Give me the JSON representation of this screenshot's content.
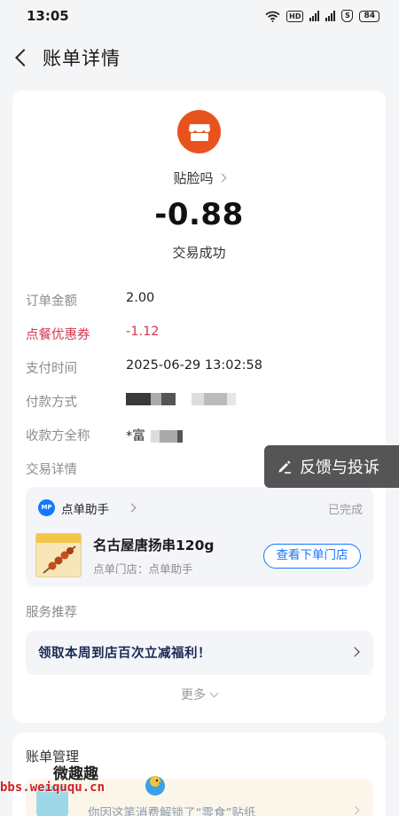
{
  "status_bar": {
    "time": "13:05",
    "hd_badge": "HD",
    "shield_badge": "S",
    "battery": "84"
  },
  "header": {
    "title": "账单详情"
  },
  "summary": {
    "merchant": "贴脸吗",
    "amount": "-0.88",
    "status": "交易成功"
  },
  "details": {
    "order_amount_label": "订单金额",
    "order_amount_value": "2.00",
    "coupon_label": "点餐优惠券",
    "coupon_value": "-1.12",
    "pay_time_label": "支付时间",
    "pay_time_value": "2025-06-29 13:02:58",
    "pay_method_label": "付款方式",
    "payee_label": "收款方全称",
    "payee_value_prefix": "*富",
    "trade_detail_label": "交易详情"
  },
  "order": {
    "mini_program_logo": "MP",
    "mini_program": "点单助手",
    "status": "已完成",
    "product_name": "名古屋唐扬串120g",
    "store_label": "点单门店：点单助手",
    "store_button": "查看下单门店"
  },
  "services": {
    "label": "服务推荐",
    "promo_text": "领取本周到店百次立减福利！",
    "more": "更多"
  },
  "bill_management": {
    "title": "账单管理",
    "sticker_text": "你因这笔消费解锁了“零食”贴纸"
  },
  "feedback": {
    "label": "反馈与投诉"
  },
  "watermark": {
    "name": "微趣趣",
    "url": "bbs.weiququ.cn"
  },
  "colors": {
    "accent_blue": "#1677ff",
    "coupon_red": "#d0374e",
    "merchant_orange": "#e8531d"
  },
  "icons": [
    "back-icon",
    "store-icon",
    "chevron-right-icon",
    "edit-icon",
    "chevron-down-icon",
    "wifi-icon",
    "signal-icon",
    "battery-icon"
  ]
}
